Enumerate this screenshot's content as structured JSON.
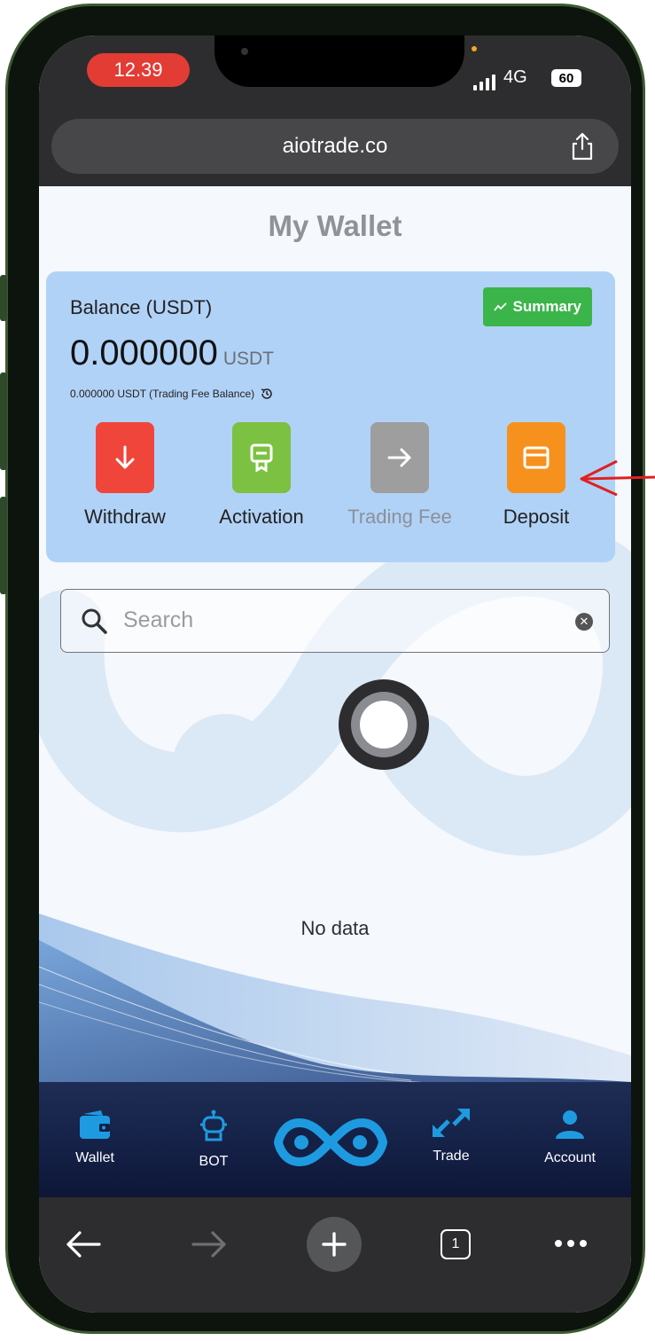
{
  "status_bar": {
    "time": "12.39",
    "network": "4G",
    "battery": "60"
  },
  "browser": {
    "url": "aiotrade.co",
    "tab_count": "1"
  },
  "page": {
    "title": "My Wallet"
  },
  "balance_card": {
    "label": "Balance (USDT)",
    "amount": "0.000000",
    "unit": "USDT",
    "fee_line": "0.000000 USDT (Trading Fee Balance)",
    "summary_label": "Summary",
    "actions": [
      {
        "label": "Withdraw",
        "color": "#f0453a",
        "icon": "arrow-down-icon"
      },
      {
        "label": "Activation",
        "color": "#7cc142",
        "icon": "certificate-icon"
      },
      {
        "label": "Trading Fee",
        "color": "#9e9e9e",
        "icon": "arrow-right-icon"
      },
      {
        "label": "Deposit",
        "color": "#f7911e",
        "icon": "card-icon"
      }
    ]
  },
  "search": {
    "placeholder": "Search"
  },
  "empty_state": {
    "text": "No data"
  },
  "bottom_nav": {
    "items": [
      {
        "label": "Wallet",
        "icon": "wallet-icon"
      },
      {
        "label": "BOT",
        "icon": "robot-icon"
      },
      {
        "label": "Trade",
        "icon": "trade-arrows-icon"
      },
      {
        "label": "Account",
        "icon": "user-icon"
      }
    ]
  },
  "colors": {
    "accent_blue": "#1e9be0",
    "card_bg": "#b1d2f7",
    "summary_green": "#3bb54a",
    "annotation_red": "#e02020"
  }
}
